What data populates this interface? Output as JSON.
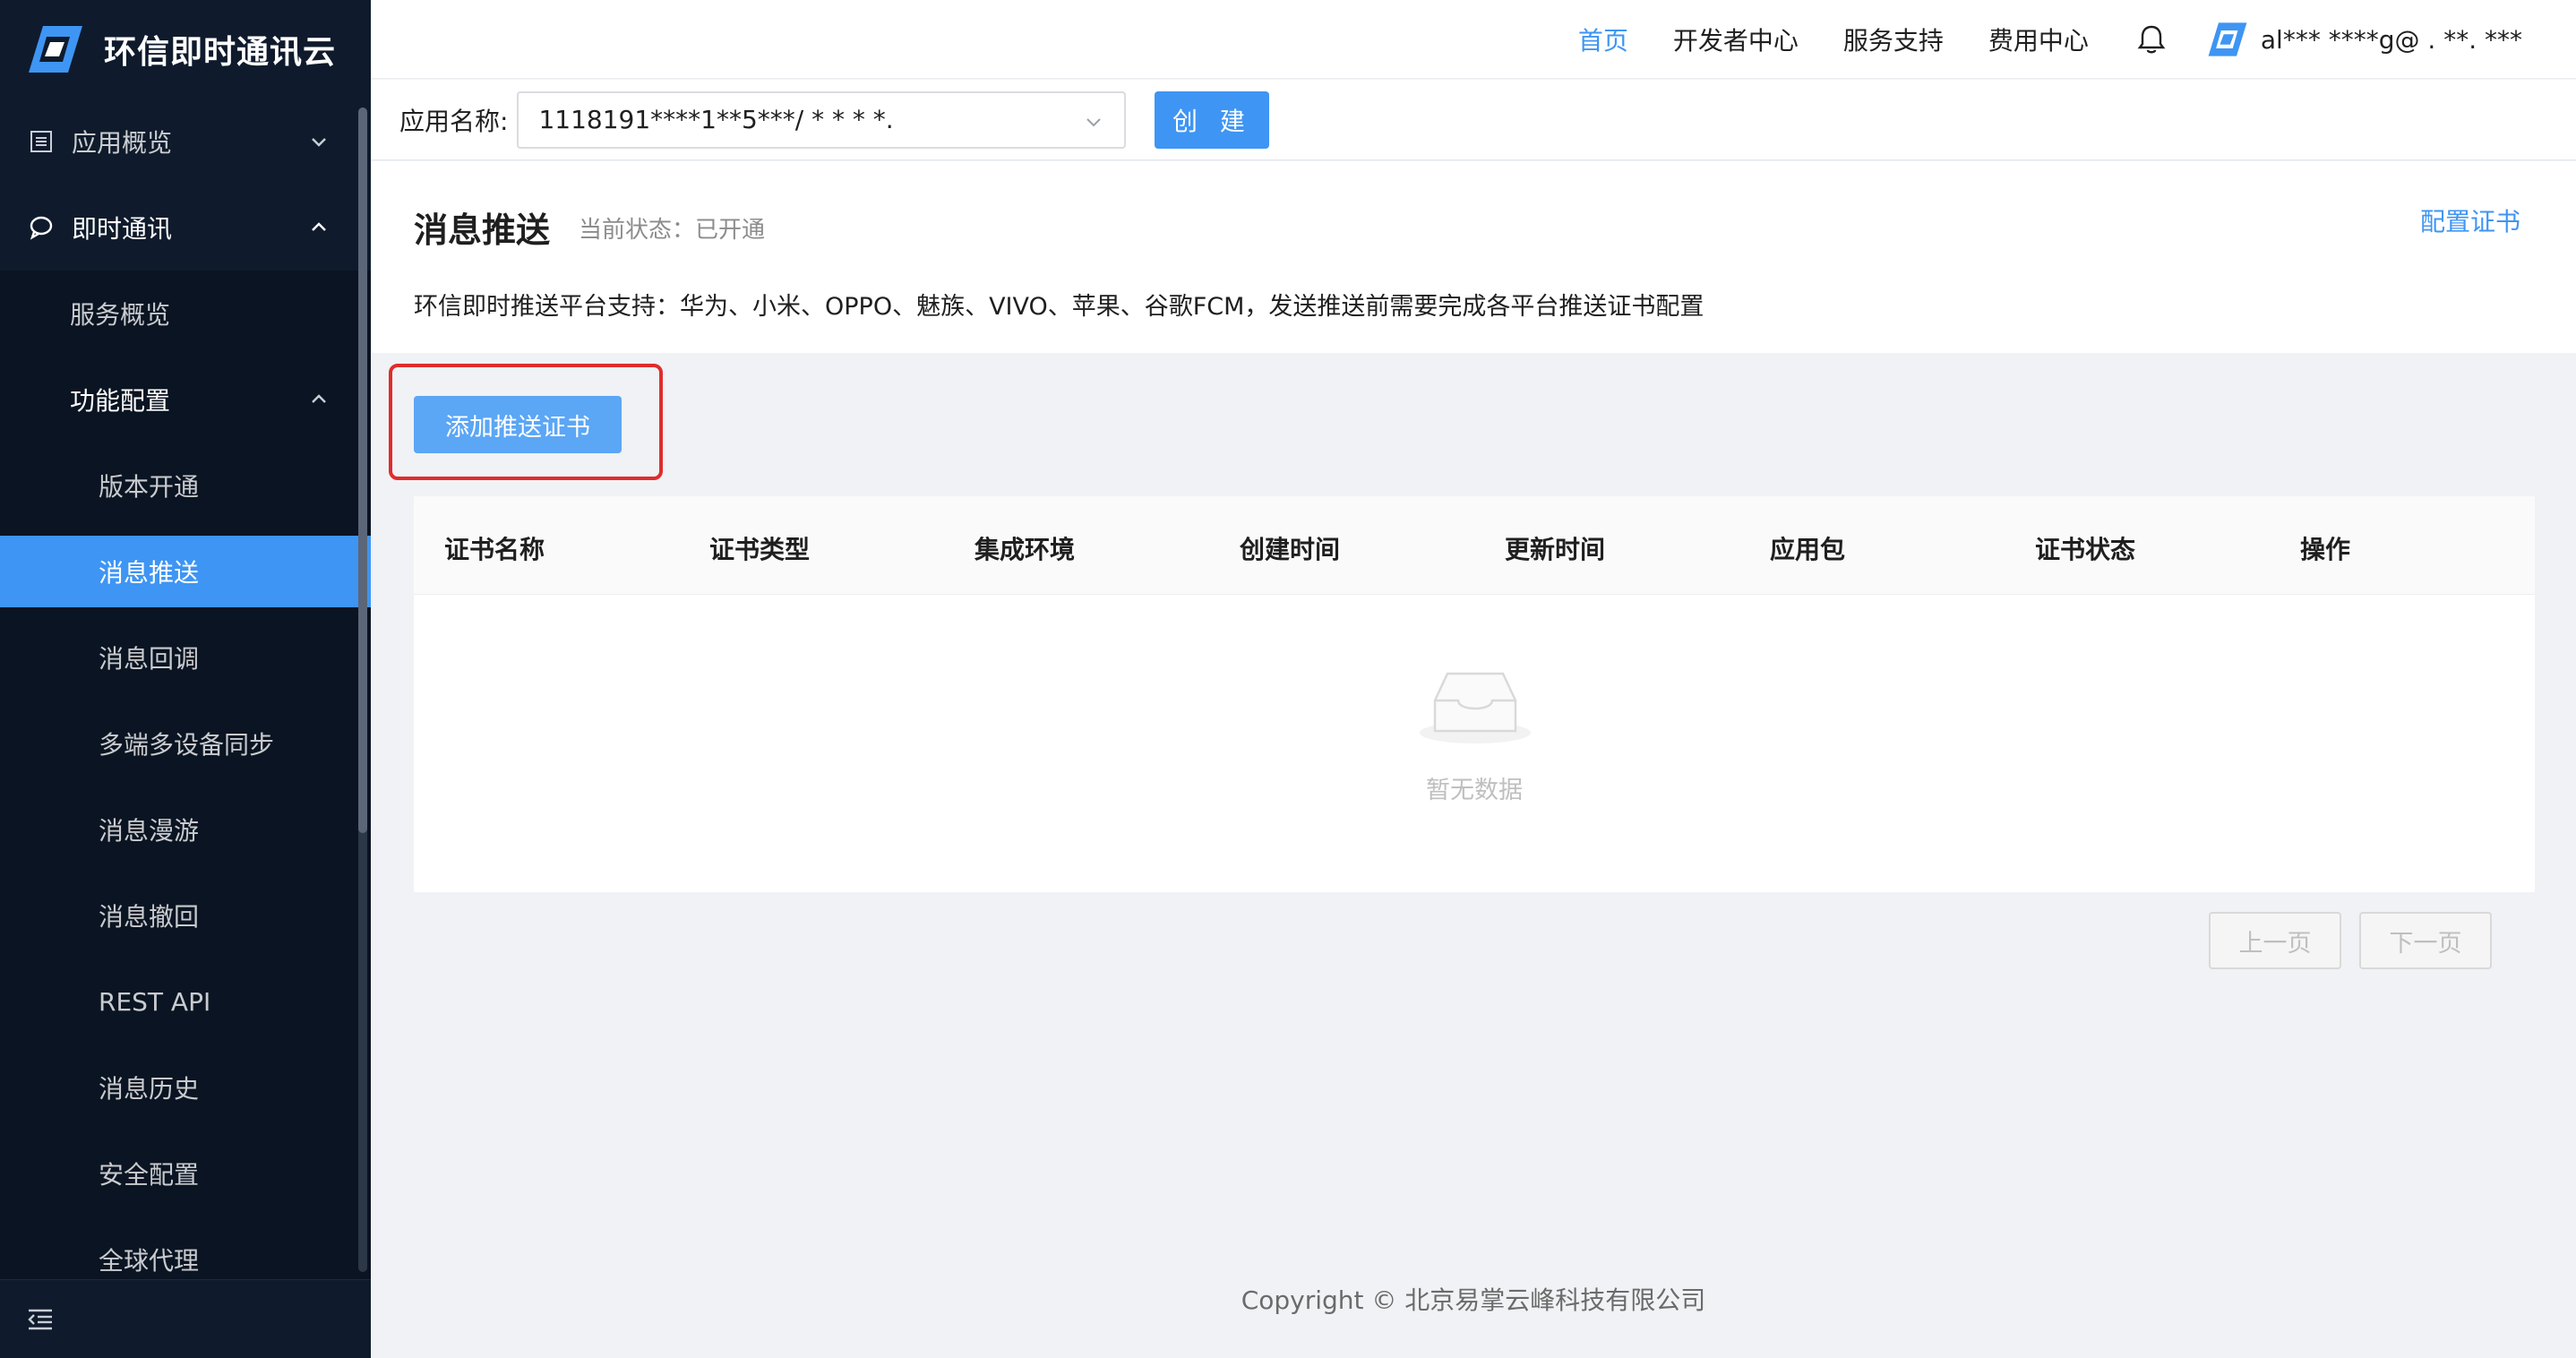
{
  "brand": {
    "name": "环信即时通讯云"
  },
  "sidebar": {
    "items": [
      {
        "label": "应用概览"
      },
      {
        "label": "即时通讯"
      },
      {
        "label": "服务概览"
      },
      {
        "label": "功能配置"
      },
      {
        "label": "版本开通"
      },
      {
        "label": "消息推送"
      },
      {
        "label": "消息回调"
      },
      {
        "label": "多端多设备同步"
      },
      {
        "label": "消息漫游"
      },
      {
        "label": "消息撤回"
      },
      {
        "label": "REST API"
      },
      {
        "label": "消息历史"
      },
      {
        "label": "安全配置"
      },
      {
        "label": "全球代理"
      }
    ]
  },
  "topbar": {
    "links": [
      "首页",
      "开发者中心",
      "服务支持",
      "费用中心"
    ],
    "user": "al*** ****g@ . **. ***"
  },
  "appbar": {
    "label": "应用名称:",
    "selected_app": "1118191****1**5***/ * * * *.",
    "create_label": "创 建"
  },
  "header": {
    "title": "消息推送",
    "status": "当前状态：已开通",
    "config_link": "配置证书",
    "description": "环信即时推送平台支持：华为、小米、OPPO、魅族、VIVO、苹果、谷歌FCM，发送推送前需要完成各平台推送证书配置"
  },
  "content": {
    "add_button": "添加推送证书",
    "columns": [
      "证书名称",
      "证书类型",
      "集成环境",
      "创建时间",
      "更新时间",
      "应用包",
      "证书状态",
      "操作"
    ],
    "empty_text": "暂无数据",
    "prev": "上一页",
    "next": "下一页"
  },
  "footer": {
    "copyright": "Copyright © 北京易掌云峰科技有限公司"
  },
  "colors": {
    "accent": "#3e95f3",
    "sidebar_bg": "#0f1b2c",
    "highlight": "#e02c2c"
  }
}
